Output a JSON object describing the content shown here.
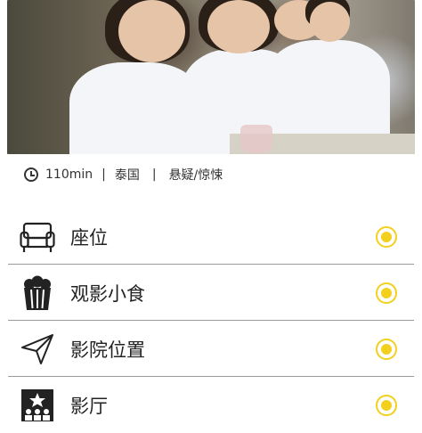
{
  "movie": {
    "duration": "110min",
    "country": "泰国",
    "separator": "|",
    "genre": "悬疑/惊悚"
  },
  "menu": {
    "items": [
      {
        "label": "座位",
        "icon": "sofa-icon",
        "selected": true
      },
      {
        "label": "观影小食",
        "icon": "popcorn-icon",
        "selected": true
      },
      {
        "label": "影院位置",
        "icon": "location-arrow-icon",
        "selected": true
      },
      {
        "label": "影厅",
        "icon": "theater-hall-icon",
        "selected": true
      }
    ],
    "accent_color": "#f2d01c"
  }
}
